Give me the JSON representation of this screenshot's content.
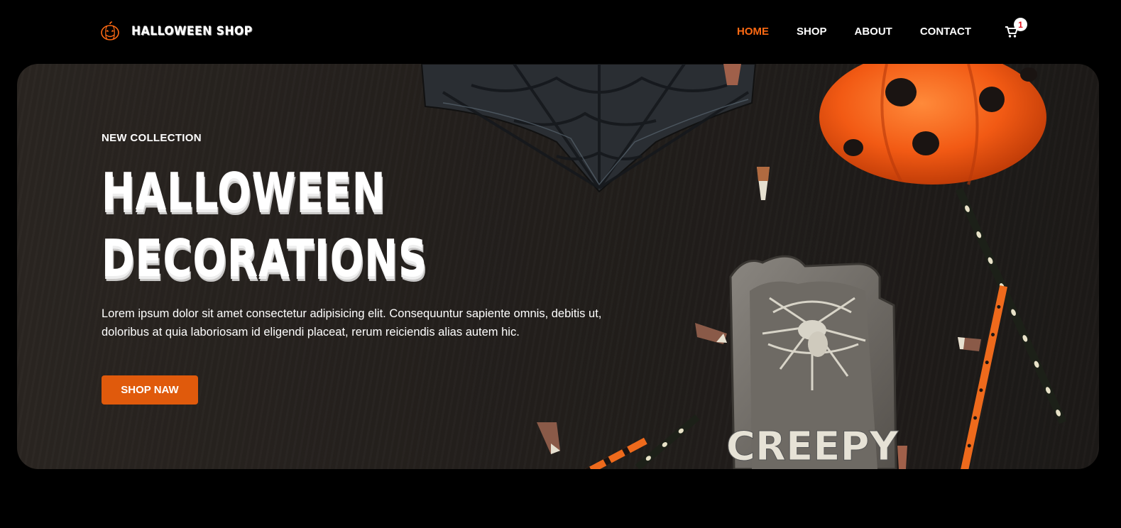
{
  "brand": {
    "name": "HALLOWEEN SHOP",
    "icon": "pumpkin-icon"
  },
  "nav": {
    "items": [
      {
        "label": "HOME",
        "active": true
      },
      {
        "label": "SHOP",
        "active": false
      },
      {
        "label": "ABOUT",
        "active": false
      },
      {
        "label": "CONTACT",
        "active": false
      }
    ],
    "cart": {
      "icon": "cart-icon",
      "count": "1"
    }
  },
  "hero": {
    "eyebrow": "NEW COLLECTION",
    "headline_line1": "HALLOWEEN",
    "headline_line2": "DECORATIONS",
    "body": "Lorem ipsum dolor sit amet consectetur adipisicing elit. Consequuntur sapiente omnis, debitis ut, doloribus at quia laboriosam id eligendi placeat, rerum reiciendis alias autem hic.",
    "cta_label": "SHOP NAW",
    "tombstone_text": "CREEPY"
  },
  "colors": {
    "accent": "#ff6a13",
    "button": "#e05a0c",
    "background": "#000000",
    "badge_text": "#e0101a"
  }
}
